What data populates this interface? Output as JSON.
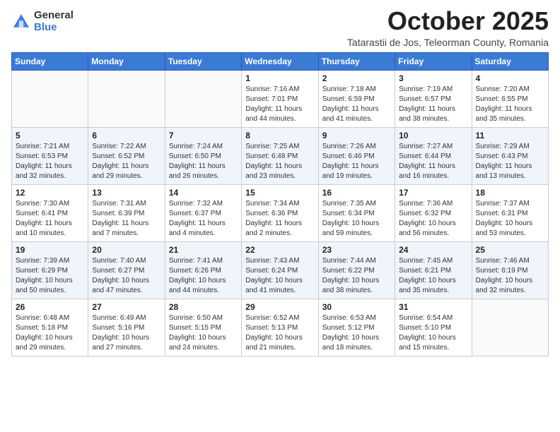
{
  "logo": {
    "general": "General",
    "blue": "Blue"
  },
  "title": "October 2025",
  "subtitle": "Tatarastii de Jos, Teleorman County, Romania",
  "days_of_week": [
    "Sunday",
    "Monday",
    "Tuesday",
    "Wednesday",
    "Thursday",
    "Friday",
    "Saturday"
  ],
  "weeks": [
    [
      {
        "day": "",
        "info": ""
      },
      {
        "day": "",
        "info": ""
      },
      {
        "day": "",
        "info": ""
      },
      {
        "day": "1",
        "info": "Sunrise: 7:16 AM\nSunset: 7:01 PM\nDaylight: 11 hours and 44 minutes."
      },
      {
        "day": "2",
        "info": "Sunrise: 7:18 AM\nSunset: 6:59 PM\nDaylight: 11 hours and 41 minutes."
      },
      {
        "day": "3",
        "info": "Sunrise: 7:19 AM\nSunset: 6:57 PM\nDaylight: 11 hours and 38 minutes."
      },
      {
        "day": "4",
        "info": "Sunrise: 7:20 AM\nSunset: 6:55 PM\nDaylight: 11 hours and 35 minutes."
      }
    ],
    [
      {
        "day": "5",
        "info": "Sunrise: 7:21 AM\nSunset: 6:53 PM\nDaylight: 11 hours and 32 minutes."
      },
      {
        "day": "6",
        "info": "Sunrise: 7:22 AM\nSunset: 6:52 PM\nDaylight: 11 hours and 29 minutes."
      },
      {
        "day": "7",
        "info": "Sunrise: 7:24 AM\nSunset: 6:50 PM\nDaylight: 11 hours and 26 minutes."
      },
      {
        "day": "8",
        "info": "Sunrise: 7:25 AM\nSunset: 6:48 PM\nDaylight: 11 hours and 23 minutes."
      },
      {
        "day": "9",
        "info": "Sunrise: 7:26 AM\nSunset: 6:46 PM\nDaylight: 11 hours and 19 minutes."
      },
      {
        "day": "10",
        "info": "Sunrise: 7:27 AM\nSunset: 6:44 PM\nDaylight: 11 hours and 16 minutes."
      },
      {
        "day": "11",
        "info": "Sunrise: 7:29 AM\nSunset: 6:43 PM\nDaylight: 11 hours and 13 minutes."
      }
    ],
    [
      {
        "day": "12",
        "info": "Sunrise: 7:30 AM\nSunset: 6:41 PM\nDaylight: 11 hours and 10 minutes."
      },
      {
        "day": "13",
        "info": "Sunrise: 7:31 AM\nSunset: 6:39 PM\nDaylight: 11 hours and 7 minutes."
      },
      {
        "day": "14",
        "info": "Sunrise: 7:32 AM\nSunset: 6:37 PM\nDaylight: 11 hours and 4 minutes."
      },
      {
        "day": "15",
        "info": "Sunrise: 7:34 AM\nSunset: 6:36 PM\nDaylight: 11 hours and 2 minutes."
      },
      {
        "day": "16",
        "info": "Sunrise: 7:35 AM\nSunset: 6:34 PM\nDaylight: 10 hours and 59 minutes."
      },
      {
        "day": "17",
        "info": "Sunrise: 7:36 AM\nSunset: 6:32 PM\nDaylight: 10 hours and 56 minutes."
      },
      {
        "day": "18",
        "info": "Sunrise: 7:37 AM\nSunset: 6:31 PM\nDaylight: 10 hours and 53 minutes."
      }
    ],
    [
      {
        "day": "19",
        "info": "Sunrise: 7:39 AM\nSunset: 6:29 PM\nDaylight: 10 hours and 50 minutes."
      },
      {
        "day": "20",
        "info": "Sunrise: 7:40 AM\nSunset: 6:27 PM\nDaylight: 10 hours and 47 minutes."
      },
      {
        "day": "21",
        "info": "Sunrise: 7:41 AM\nSunset: 6:26 PM\nDaylight: 10 hours and 44 minutes."
      },
      {
        "day": "22",
        "info": "Sunrise: 7:43 AM\nSunset: 6:24 PM\nDaylight: 10 hours and 41 minutes."
      },
      {
        "day": "23",
        "info": "Sunrise: 7:44 AM\nSunset: 6:22 PM\nDaylight: 10 hours and 38 minutes."
      },
      {
        "day": "24",
        "info": "Sunrise: 7:45 AM\nSunset: 6:21 PM\nDaylight: 10 hours and 35 minutes."
      },
      {
        "day": "25",
        "info": "Sunrise: 7:46 AM\nSunset: 6:19 PM\nDaylight: 10 hours and 32 minutes."
      }
    ],
    [
      {
        "day": "26",
        "info": "Sunrise: 6:48 AM\nSunset: 5:18 PM\nDaylight: 10 hours and 29 minutes."
      },
      {
        "day": "27",
        "info": "Sunrise: 6:49 AM\nSunset: 5:16 PM\nDaylight: 10 hours and 27 minutes."
      },
      {
        "day": "28",
        "info": "Sunrise: 6:50 AM\nSunset: 5:15 PM\nDaylight: 10 hours and 24 minutes."
      },
      {
        "day": "29",
        "info": "Sunrise: 6:52 AM\nSunset: 5:13 PM\nDaylight: 10 hours and 21 minutes."
      },
      {
        "day": "30",
        "info": "Sunrise: 6:53 AM\nSunset: 5:12 PM\nDaylight: 10 hours and 18 minutes."
      },
      {
        "day": "31",
        "info": "Sunrise: 6:54 AM\nSunset: 5:10 PM\nDaylight: 10 hours and 15 minutes."
      },
      {
        "day": "",
        "info": ""
      }
    ]
  ]
}
